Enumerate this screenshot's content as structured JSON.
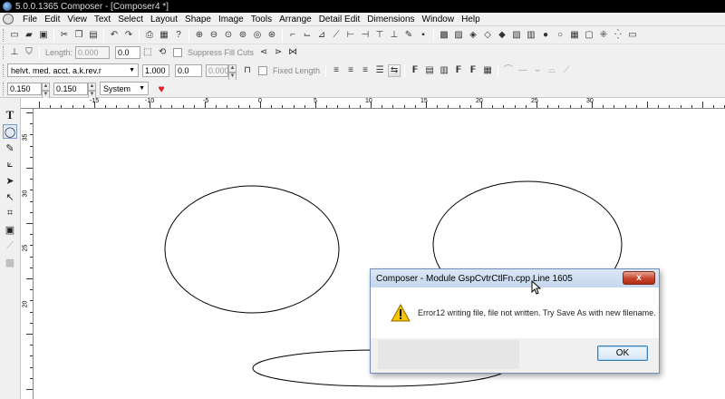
{
  "window": {
    "title": "5.0.0.1365 Composer - [Composer4 *]"
  },
  "menu": {
    "items": [
      "File",
      "Edit",
      "View",
      "Text",
      "Select",
      "Layout",
      "Shape",
      "Image",
      "Tools",
      "Arrange",
      "Detail Edit",
      "Dimensions",
      "Window",
      "Help"
    ]
  },
  "toolbar_length": {
    "length_label": "Length:",
    "length_value": "0.000",
    "value2": "0.0",
    "suppress_label": "Suppress Fill Cuts"
  },
  "toolbar_font": {
    "font_name": "helvt. med. acct. a.k.rev.r",
    "size": "1.000",
    "value2": "0.0",
    "value3": "0.000",
    "fixed_length_label": "Fixed Length"
  },
  "toolbar_spacing": {
    "value1": "0.150",
    "value2": "0.150",
    "unit_system": "System"
  },
  "ruler": {
    "h_labels": [
      "-15",
      "-10",
      "-5",
      "0",
      "5",
      "10",
      "15",
      "20",
      "25",
      "30"
    ],
    "v_labels": [
      "35",
      "30",
      "25",
      "20"
    ]
  },
  "dialog": {
    "title": "Composer - Module GspCvtrCtlFn.cpp Line 1605",
    "message": "Error12 writing file, file not written.  Try Save As with new filename.",
    "ok_label": "OK",
    "close_label": "x"
  },
  "colors": {
    "favorite_heart": "#e02020",
    "dialog_border": "#6f8fb8"
  }
}
